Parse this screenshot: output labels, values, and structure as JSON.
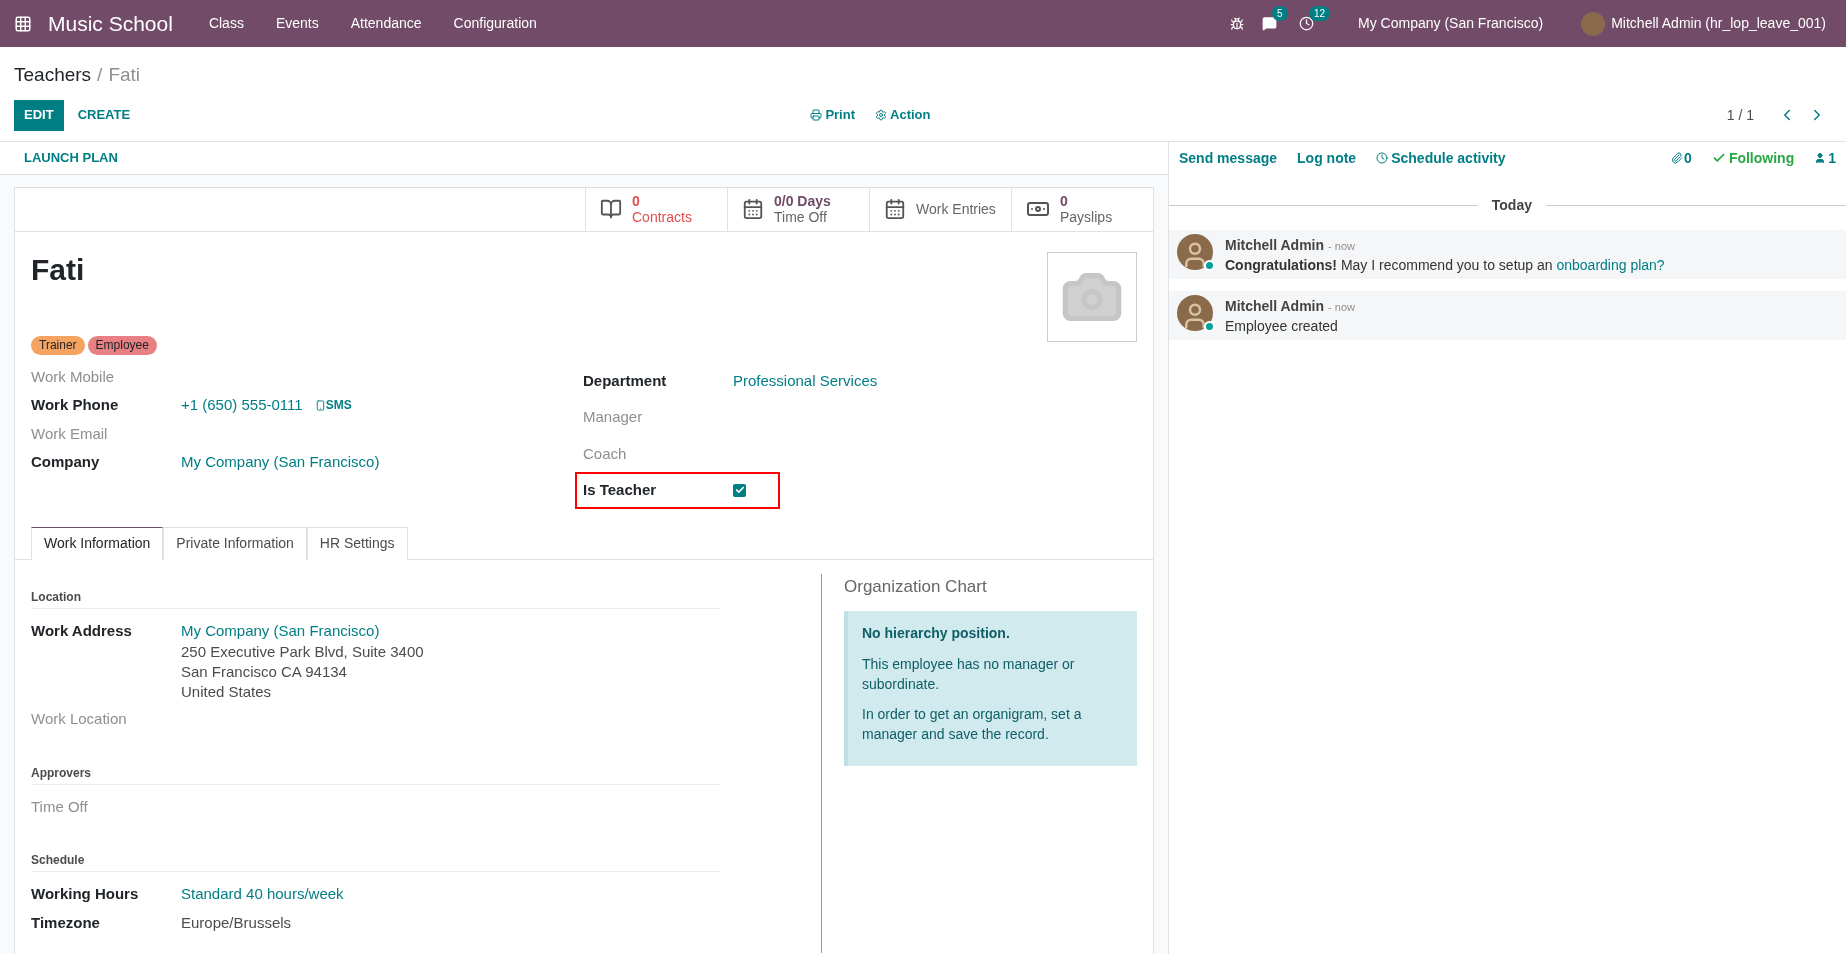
{
  "navbar": {
    "app_name": "Music School",
    "menu": [
      "Class",
      "Events",
      "Attendance",
      "Configuration"
    ],
    "messages_count": "5",
    "activities_count": "12",
    "company": "My Company (San Francisco)",
    "user": "Mitchell Admin (hr_lop_leave_001)"
  },
  "breadcrumb": {
    "parent": "Teachers",
    "separator": "/",
    "current": "Fati"
  },
  "buttons": {
    "edit": "EDIT",
    "create": "CREATE",
    "print": "Print",
    "action": "Action"
  },
  "pager": "1 / 1",
  "status_bar": {
    "button": "LAUNCH PLAN"
  },
  "stat_buttons": [
    {
      "kind": "book",
      "count": "0",
      "label": "Contracts",
      "warning": true
    },
    {
      "kind": "calendar",
      "count": "0/0 Days",
      "label": "Time Off",
      "warning": false
    },
    {
      "kind": "calendar",
      "label": "Work Entries",
      "warning": false
    },
    {
      "kind": "money",
      "count": "0",
      "label": "Payslips",
      "warning": false
    }
  ],
  "employee_name": "Fati",
  "tags": [
    {
      "label": "Trainer",
      "color": "#f4a460"
    },
    {
      "label": "Employee",
      "color": "#e87f82"
    }
  ],
  "left_fields": [
    {
      "label": "Work Mobile",
      "kind": "text"
    },
    {
      "label": "Work Phone",
      "kind": "phone",
      "value": "+1 (650) 555-0111",
      "sms": "SMS"
    },
    {
      "label": "Work Email",
      "kind": "text"
    },
    {
      "label": "Company",
      "kind": "link",
      "value": "My Company (San Francisco)"
    }
  ],
  "right_fields": [
    {
      "label": "Department",
      "kind": "link",
      "value": "Professional Services",
      "highlighted": false
    },
    {
      "label": "Manager",
      "kind": "text",
      "highlighted": false
    },
    {
      "label": "Coach",
      "kind": "text",
      "highlighted": false
    },
    {
      "label": "Is Teacher",
      "kind": "checkbox",
      "checked": true,
      "highlighted": true
    }
  ],
  "tabs": [
    {
      "label": "Work Information",
      "selected": true
    },
    {
      "label": "Private Information",
      "selected": false
    },
    {
      "label": "HR Settings",
      "selected": false
    }
  ],
  "sections": [
    {
      "title": "Location",
      "fields": [
        {
          "label": "Work Address",
          "kind": "link",
          "value": "My Company (San Francisco)",
          "lines": [
            "250 Executive Park Blvd, Suite 3400",
            "San Francisco CA 94134",
            "United States"
          ]
        },
        {
          "label": "Work Location",
          "kind": "text"
        }
      ]
    },
    {
      "title": "Approvers",
      "fields": [
        {
          "label": "Time Off",
          "kind": "text"
        }
      ]
    },
    {
      "title": "Schedule",
      "fields": [
        {
          "label": "Working Hours",
          "kind": "link",
          "value": "Standard 40 hours/week"
        },
        {
          "label": "Timezone",
          "kind": "text",
          "value": "Europe/Brussels"
        }
      ]
    }
  ],
  "org_chart": {
    "title": "Organization Chart",
    "heading": "No hierarchy position.",
    "paragraphs": [
      "This employee has no manager or subordinate.",
      "In order to get an organigram, set a manager and save the record."
    ]
  },
  "chatter": {
    "send_message": "Send message",
    "log_note": "Log note",
    "schedule_activity": "Schedule activity",
    "attachments": "0",
    "following": "Following",
    "followers": "1",
    "date_separator": "Today",
    "messages": [
      {
        "author": "Mitchell Admin",
        "time": "- now",
        "online": true,
        "body": "**Congratulations!** May I recommend you to setup an",
        "link": "onboarding plan?"
      },
      {
        "author": "Mitchell Admin",
        "time": "- now",
        "online": true,
        "body": "Employee created"
      }
    ]
  }
}
